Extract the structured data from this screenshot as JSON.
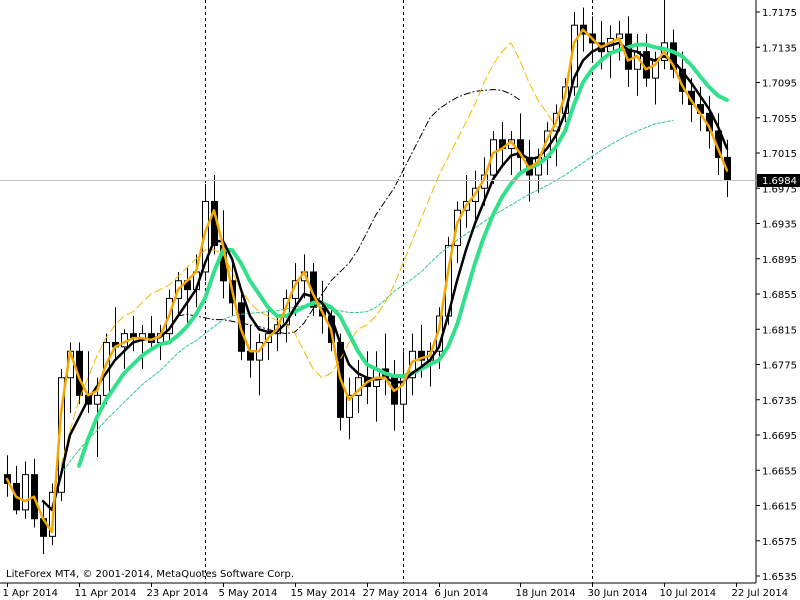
{
  "window": {
    "copyright": "LiteForex MT4, © 2001-2014, MetaQuotes Software Corp."
  },
  "colors": {
    "background": "#ffffff",
    "candle": "#000000",
    "grid_separator": "#000000",
    "current_price_line": "#c0c0c0",
    "ma_fast": "#f5a800",
    "ma_mid": "#000000",
    "ma_slow": "#33e08a",
    "ma_long_dashed": "#33c98a",
    "envelope_dash": "#f5b800"
  },
  "chart_data": {
    "type": "candlestick",
    "title": "",
    "xlabel": "",
    "ylabel": "",
    "ylim": [
      1.6525,
      1.7195
    ],
    "grid": false,
    "current_price": 1.6984,
    "current_price_label": "1.6984",
    "y_ticks": [
      "1.7175",
      "1.7135",
      "1.7095",
      "1.7055",
      "1.7015",
      "1.6975",
      "1.6935",
      "1.6895",
      "1.6855",
      "1.6815",
      "1.6775",
      "1.6735",
      "1.6695",
      "1.6655",
      "1.6615",
      "1.6575",
      "1.6535"
    ],
    "x_ticks": [
      {
        "label": "1 Apr 2014",
        "index": 0
      },
      {
        "label": "11 Apr 2014",
        "index": 8
      },
      {
        "label": "23 Apr 2014",
        "index": 16
      },
      {
        "label": "5 May 2014",
        "index": 24
      },
      {
        "label": "15 May 2014",
        "index": 32
      },
      {
        "label": "27 May 2014",
        "index": 40
      },
      {
        "label": "6 Jun 2014",
        "index": 48
      },
      {
        "label": "18 Jun 2014",
        "index": 57
      },
      {
        "label": "30 Jun 2014",
        "index": 65
      },
      {
        "label": "10 Jul 2014",
        "index": 73
      },
      {
        "label": "22 Jul 2014",
        "index": 81
      }
    ],
    "separators_at_index": [
      22,
      44,
      65
    ],
    "candles": [
      {
        "o": 1.665,
        "h": 1.6672,
        "l": 1.6625,
        "c": 1.664
      },
      {
        "o": 1.664,
        "h": 1.666,
        "l": 1.6605,
        "c": 1.661
      },
      {
        "o": 1.661,
        "h": 1.6665,
        "l": 1.66,
        "c": 1.665
      },
      {
        "o": 1.665,
        "h": 1.6668,
        "l": 1.659,
        "c": 1.66
      },
      {
        "o": 1.66,
        "h": 1.662,
        "l": 1.656,
        "c": 1.658
      },
      {
        "o": 1.658,
        "h": 1.664,
        "l": 1.657,
        "c": 1.663
      },
      {
        "o": 1.663,
        "h": 1.677,
        "l": 1.662,
        "c": 1.676
      },
      {
        "o": 1.676,
        "h": 1.68,
        "l": 1.672,
        "c": 1.679
      },
      {
        "o": 1.679,
        "h": 1.68,
        "l": 1.673,
        "c": 1.674
      },
      {
        "o": 1.674,
        "h": 1.679,
        "l": 1.672,
        "c": 1.673
      },
      {
        "o": 1.673,
        "h": 1.676,
        "l": 1.667,
        "c": 1.674
      },
      {
        "o": 1.674,
        "h": 1.681,
        "l": 1.673,
        "c": 1.68
      },
      {
        "o": 1.68,
        "h": 1.684,
        "l": 1.678,
        "c": 1.6795
      },
      {
        "o": 1.6795,
        "h": 1.6815,
        "l": 1.677,
        "c": 1.681
      },
      {
        "o": 1.681,
        "h": 1.683,
        "l": 1.679,
        "c": 1.6805
      },
      {
        "o": 1.6805,
        "h": 1.682,
        "l": 1.677,
        "c": 1.681
      },
      {
        "o": 1.681,
        "h": 1.683,
        "l": 1.679,
        "c": 1.68
      },
      {
        "o": 1.68,
        "h": 1.682,
        "l": 1.678,
        "c": 1.681
      },
      {
        "o": 1.681,
        "h": 1.686,
        "l": 1.68,
        "c": 1.685
      },
      {
        "o": 1.685,
        "h": 1.688,
        "l": 1.683,
        "c": 1.687
      },
      {
        "o": 1.687,
        "h": 1.6885,
        "l": 1.682,
        "c": 1.686
      },
      {
        "o": 1.686,
        "h": 1.69,
        "l": 1.684,
        "c": 1.688
      },
      {
        "o": 1.688,
        "h": 1.698,
        "l": 1.687,
        "c": 1.696
      },
      {
        "o": 1.696,
        "h": 1.699,
        "l": 1.69,
        "c": 1.691
      },
      {
        "o": 1.691,
        "h": 1.695,
        "l": 1.685,
        "c": 1.687
      },
      {
        "o": 1.687,
        "h": 1.689,
        "l": 1.683,
        "c": 1.6845
      },
      {
        "o": 1.6845,
        "h": 1.686,
        "l": 1.678,
        "c": 1.679
      },
      {
        "o": 1.679,
        "h": 1.682,
        "l": 1.676,
        "c": 1.678
      },
      {
        "o": 1.678,
        "h": 1.681,
        "l": 1.674,
        "c": 1.68
      },
      {
        "o": 1.68,
        "h": 1.684,
        "l": 1.678,
        "c": 1.681
      },
      {
        "o": 1.681,
        "h": 1.683,
        "l": 1.679,
        "c": 1.682
      },
      {
        "o": 1.682,
        "h": 1.686,
        "l": 1.68,
        "c": 1.685
      },
      {
        "o": 1.685,
        "h": 1.689,
        "l": 1.683,
        "c": 1.687
      },
      {
        "o": 1.687,
        "h": 1.69,
        "l": 1.685,
        "c": 1.688
      },
      {
        "o": 1.688,
        "h": 1.689,
        "l": 1.683,
        "c": 1.684
      },
      {
        "o": 1.684,
        "h": 1.687,
        "l": 1.681,
        "c": 1.683
      },
      {
        "o": 1.683,
        "h": 1.684,
        "l": 1.679,
        "c": 1.68
      },
      {
        "o": 1.68,
        "h": 1.681,
        "l": 1.67,
        "c": 1.6715
      },
      {
        "o": 1.6715,
        "h": 1.676,
        "l": 1.669,
        "c": 1.674
      },
      {
        "o": 1.674,
        "h": 1.678,
        "l": 1.672,
        "c": 1.676
      },
      {
        "o": 1.676,
        "h": 1.679,
        "l": 1.673,
        "c": 1.675
      },
      {
        "o": 1.675,
        "h": 1.679,
        "l": 1.671,
        "c": 1.677
      },
      {
        "o": 1.677,
        "h": 1.681,
        "l": 1.674,
        "c": 1.676
      },
      {
        "o": 1.676,
        "h": 1.678,
        "l": 1.67,
        "c": 1.673
      },
      {
        "o": 1.673,
        "h": 1.679,
        "l": 1.671,
        "c": 1.676
      },
      {
        "o": 1.676,
        "h": 1.681,
        "l": 1.674,
        "c": 1.679
      },
      {
        "o": 1.679,
        "h": 1.682,
        "l": 1.676,
        "c": 1.678
      },
      {
        "o": 1.678,
        "h": 1.68,
        "l": 1.675,
        "c": 1.679
      },
      {
        "o": 1.679,
        "h": 1.684,
        "l": 1.677,
        "c": 1.683
      },
      {
        "o": 1.683,
        "h": 1.692,
        "l": 1.682,
        "c": 1.691
      },
      {
        "o": 1.691,
        "h": 1.696,
        "l": 1.689,
        "c": 1.695
      },
      {
        "o": 1.695,
        "h": 1.699,
        "l": 1.693,
        "c": 1.696
      },
      {
        "o": 1.696,
        "h": 1.6995,
        "l": 1.694,
        "c": 1.6975
      },
      {
        "o": 1.6975,
        "h": 1.701,
        "l": 1.6955,
        "c": 1.699
      },
      {
        "o": 1.699,
        "h": 1.704,
        "l": 1.698,
        "c": 1.703
      },
      {
        "o": 1.703,
        "h": 1.705,
        "l": 1.7,
        "c": 1.702
      },
      {
        "o": 1.702,
        "h": 1.704,
        "l": 1.699,
        "c": 1.703
      },
      {
        "o": 1.703,
        "h": 1.706,
        "l": 1.6995,
        "c": 1.701
      },
      {
        "o": 1.701,
        "h": 1.703,
        "l": 1.696,
        "c": 1.699
      },
      {
        "o": 1.699,
        "h": 1.702,
        "l": 1.697,
        "c": 1.701
      },
      {
        "o": 1.701,
        "h": 1.705,
        "l": 1.699,
        "c": 1.704
      },
      {
        "o": 1.704,
        "h": 1.707,
        "l": 1.7,
        "c": 1.706
      },
      {
        "o": 1.706,
        "h": 1.71,
        "l": 1.705,
        "c": 1.709
      },
      {
        "o": 1.709,
        "h": 1.7175,
        "l": 1.708,
        "c": 1.716
      },
      {
        "o": 1.716,
        "h": 1.718,
        "l": 1.713,
        "c": 1.715
      },
      {
        "o": 1.715,
        "h": 1.717,
        "l": 1.712,
        "c": 1.714
      },
      {
        "o": 1.714,
        "h": 1.7165,
        "l": 1.711,
        "c": 1.713
      },
      {
        "o": 1.713,
        "h": 1.716,
        "l": 1.71,
        "c": 1.7145
      },
      {
        "o": 1.7145,
        "h": 1.7165,
        "l": 1.712,
        "c": 1.715
      },
      {
        "o": 1.715,
        "h": 1.717,
        "l": 1.709,
        "c": 1.711
      },
      {
        "o": 1.711,
        "h": 1.715,
        "l": 1.708,
        "c": 1.713
      },
      {
        "o": 1.713,
        "h": 1.715,
        "l": 1.709,
        "c": 1.71
      },
      {
        "o": 1.71,
        "h": 1.713,
        "l": 1.707,
        "c": 1.712
      },
      {
        "o": 1.712,
        "h": 1.719,
        "l": 1.711,
        "c": 1.714
      },
      {
        "o": 1.714,
        "h": 1.7155,
        "l": 1.71,
        "c": 1.711
      },
      {
        "o": 1.711,
        "h": 1.713,
        "l": 1.707,
        "c": 1.7085
      },
      {
        "o": 1.7085,
        "h": 1.71,
        "l": 1.705,
        "c": 1.707
      },
      {
        "o": 1.707,
        "h": 1.709,
        "l": 1.704,
        "c": 1.706
      },
      {
        "o": 1.706,
        "h": 1.708,
        "l": 1.702,
        "c": 1.704
      },
      {
        "o": 1.704,
        "h": 1.706,
        "l": 1.699,
        "c": 1.701
      },
      {
        "o": 1.701,
        "h": 1.703,
        "l": 1.6965,
        "c": 1.6984
      }
    ],
    "series": [
      {
        "style": "fast",
        "values": [
          1.6645,
          1.6625,
          1.662,
          1.6625,
          1.66,
          1.6585,
          1.672,
          1.679,
          1.676,
          1.674,
          1.6745,
          1.6775,
          1.6795,
          1.68,
          1.6805,
          1.6805,
          1.6803,
          1.6807,
          1.683,
          1.686,
          1.687,
          1.688,
          1.6925,
          1.695,
          1.691,
          1.686,
          1.6815,
          1.679,
          1.679,
          1.6805,
          1.6815,
          1.684,
          1.6865,
          1.688,
          1.6855,
          1.6835,
          1.6815,
          1.676,
          1.6735,
          1.6745,
          1.6755,
          1.676,
          1.676,
          1.6745,
          1.6752,
          1.6778,
          1.6782,
          1.6785,
          1.6815,
          1.688,
          1.6935,
          1.6955,
          1.6968,
          1.6985,
          1.7015,
          1.702,
          1.7028,
          1.7015,
          1.6998,
          1.7005,
          1.703,
          1.705,
          1.708,
          1.714,
          1.7155,
          1.7145,
          1.7135,
          1.714,
          1.7145,
          1.712,
          1.7125,
          1.711,
          1.7115,
          1.713,
          1.7115,
          1.7092,
          1.7075,
          1.706,
          1.7045,
          1.702,
          1.6995
        ]
      },
      {
        "style": "mid",
        "values": [
          null,
          null,
          null,
          null,
          1.662,
          1.661,
          1.665,
          1.6695,
          1.6715,
          1.6735,
          1.675,
          1.6765,
          1.678,
          1.679,
          1.68,
          1.6803,
          1.6805,
          1.6806,
          1.6815,
          1.683,
          1.6845,
          1.686,
          1.689,
          1.6915,
          1.6915,
          1.6895,
          1.686,
          1.683,
          1.6815,
          1.6812,
          1.6812,
          1.6822,
          1.684,
          1.6855,
          1.6852,
          1.6845,
          1.683,
          1.68,
          1.6775,
          1.6765,
          1.676,
          1.6758,
          1.676,
          1.6755,
          1.6755,
          1.6765,
          1.6772,
          1.678,
          1.6795,
          1.683,
          1.687,
          1.6905,
          1.6935,
          1.696,
          1.6985,
          1.7,
          1.7012,
          1.7015,
          1.7008,
          1.701,
          1.702,
          1.7035,
          1.706,
          1.71,
          1.712,
          1.713,
          1.7135,
          1.7137,
          1.714,
          1.7132,
          1.713,
          1.7123,
          1.712,
          1.7125,
          1.712,
          1.7108,
          1.7095,
          1.708,
          1.7065,
          1.7045,
          1.702
        ]
      },
      {
        "style": "slow",
        "values": [
          null,
          null,
          null,
          null,
          null,
          null,
          null,
          null,
          1.666,
          1.669,
          1.6715,
          1.6735,
          1.675,
          1.6765,
          1.6775,
          1.6785,
          1.6792,
          1.6798,
          1.68,
          1.6808,
          1.6818,
          1.6832,
          1.685,
          1.688,
          1.6905,
          1.6905,
          1.689,
          1.687,
          1.6855,
          1.684,
          1.683,
          1.683,
          1.6835,
          1.684,
          1.6845,
          1.6845,
          1.684,
          1.683,
          1.681,
          1.679,
          1.6775,
          1.677,
          1.6765,
          1.6762,
          1.6762,
          1.6765,
          1.677,
          1.6775,
          1.678,
          1.6795,
          1.682,
          1.6855,
          1.689,
          1.692,
          1.6945,
          1.6965,
          1.698,
          1.6992,
          1.6998,
          1.7002,
          1.701,
          1.7022,
          1.704,
          1.707,
          1.7095,
          1.711,
          1.712,
          1.7128,
          1.7132,
          1.7135,
          1.7138,
          1.7138,
          1.7135,
          1.7133,
          1.713,
          1.7125,
          1.7115,
          1.7102,
          1.709,
          1.708,
          1.7075
        ]
      },
      {
        "style": "long",
        "values": [
          null,
          null,
          null,
          null,
          null,
          null,
          1.665,
          1.6665,
          1.6678,
          1.669,
          1.67,
          1.6712,
          1.6722,
          1.6732,
          1.6742,
          1.6752,
          1.676,
          1.6768,
          1.6778,
          1.6788,
          1.6796,
          1.6802,
          1.681,
          1.6818,
          1.6826,
          1.683,
          1.6832,
          1.6833,
          1.6834,
          1.6835,
          1.6836,
          1.6838,
          1.684,
          1.6842,
          1.6842,
          1.684,
          1.6838,
          1.6836,
          1.6834,
          1.6834,
          1.6835,
          1.684,
          1.6848,
          1.6858,
          1.6865,
          1.6872,
          1.688,
          1.689,
          1.69,
          1.6908,
          1.6916,
          1.6923,
          1.693,
          1.6937,
          1.6944,
          1.695,
          1.6956,
          1.6962,
          1.6968,
          1.6973,
          1.6978,
          1.6984,
          1.699,
          1.6997,
          1.7004,
          1.7011,
          1.7018,
          1.7024,
          1.703,
          1.7035,
          1.704,
          1.7044,
          1.7048,
          1.705,
          1.7052
        ]
      },
      {
        "style": "envelope",
        "values": [
          null,
          null,
          null,
          null,
          null,
          null,
          1.666,
          1.67,
          1.6735,
          1.676,
          1.6785,
          1.6805,
          1.682,
          1.683,
          1.6835,
          1.6845,
          1.6855,
          1.686,
          1.6865,
          1.6875,
          1.6885,
          1.6895,
          1.6905,
          1.6905,
          1.69,
          1.688,
          1.686,
          1.6845,
          1.6835,
          1.683,
          1.6825,
          1.682,
          1.681,
          1.679,
          1.677,
          1.676,
          1.6765,
          1.678,
          1.68,
          1.6815,
          1.682,
          1.683,
          1.6845,
          1.6865,
          1.689,
          1.6915,
          1.694,
          1.6965,
          1.699,
          1.701,
          1.703,
          1.705,
          1.707,
          1.7095,
          1.7115,
          1.713,
          1.714,
          1.712,
          1.7095,
          1.7075,
          1.706,
          1.7045,
          1.704
        ]
      },
      {
        "style": "dashdot",
        "values": [
          null,
          null,
          null,
          null,
          null,
          null,
          null,
          null,
          null,
          null,
          null,
          null,
          null,
          null,
          null,
          null,
          null,
          null,
          null,
          1.683,
          1.6832,
          1.683,
          1.6828,
          1.6826,
          1.6826,
          1.6824,
          1.6822,
          1.682,
          1.6818,
          1.6815,
          1.6812,
          1.681,
          1.6812,
          1.6822,
          1.6838,
          1.6855,
          1.687,
          1.688,
          1.689,
          1.6905,
          1.6925,
          1.6945,
          1.696,
          1.6975,
          1.6995,
          1.7015,
          1.7035,
          1.7055,
          1.7065,
          1.7072,
          1.7078,
          1.7082,
          1.7085,
          1.7086,
          1.7087,
          1.7086,
          1.7082,
          1.7075
        ]
      }
    ]
  }
}
